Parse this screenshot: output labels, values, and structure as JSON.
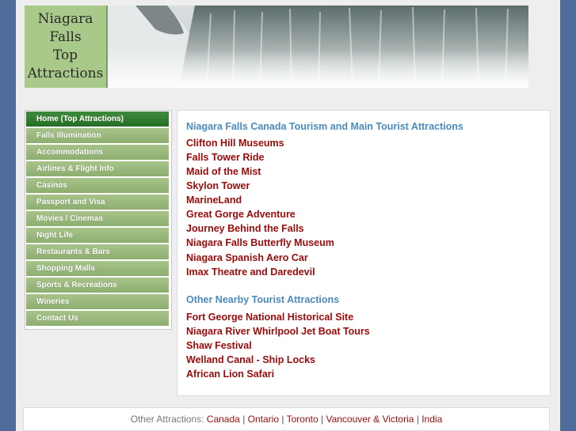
{
  "logo": {
    "line1": "Niagara",
    "line2": "Falls",
    "line3": "Top",
    "line4": "Attractions"
  },
  "nav": {
    "items": [
      "Home (Top Attractions)",
      "Falls Illumination",
      "Accommodations",
      "Airlines & Flight Info",
      "Casinos",
      "Passport and Visa",
      "Movies / Cinemas",
      "Night Life",
      "Restaurants & Bars",
      "Shopping Malls",
      "Sports & Recreations",
      "Wineries",
      "Contact Us"
    ]
  },
  "main": {
    "section1_title": "Niagara Falls Canada Tourism and Main Tourist Attractions",
    "section1_items": [
      "Clifton Hill Museums",
      "Falls Tower Ride",
      "Maid of the Mist",
      "Skylon Tower",
      "MarineLand",
      "Great Gorge Adventure",
      "Journey Behind the Falls",
      "Niagara Falls Butterfly Museum",
      "Niagara Spanish Aero Car",
      "Imax Theatre and Daredevil"
    ],
    "section2_title": "Other Nearby Tourist Attractions",
    "section2_items": [
      "Fort George National Historical Site",
      "Niagara River Whirlpool Jet Boat Tours",
      "Shaw Festival",
      "Welland Canal - Ship Locks",
      "African Lion Safari"
    ]
  },
  "footer": {
    "label": "Other Attractions:",
    "links": [
      "Canada",
      "Ontario",
      "Toronto",
      "Vancouver & Victoria",
      "India"
    ]
  },
  "colors": {
    "background": "#4f6b9a",
    "nav_green": "#8eae70",
    "nav_active": "#2e7d2e",
    "link_red": "#9a0a0a",
    "heading_blue": "#4a8bbd"
  }
}
